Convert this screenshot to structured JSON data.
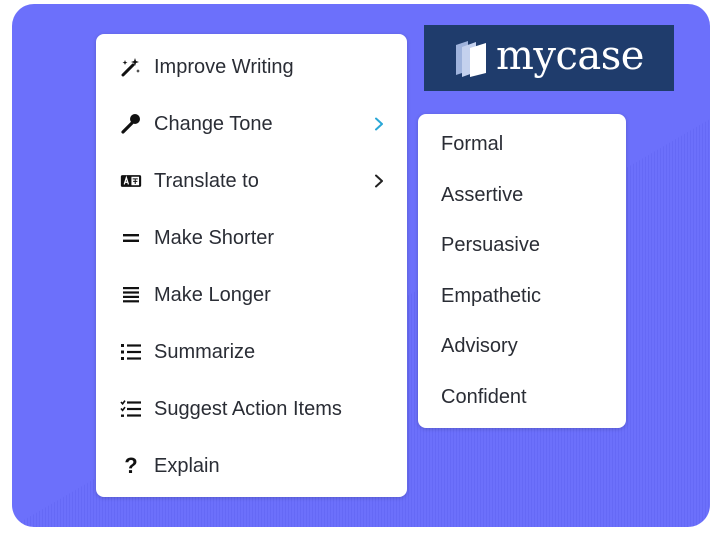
{
  "logo": {
    "text": "mycase"
  },
  "menu": {
    "items": [
      {
        "label": "Improve Writing",
        "icon": "magic-wand-icon"
      },
      {
        "label": "Change Tone",
        "icon": "microphone-icon",
        "has_submenu": true,
        "active": true
      },
      {
        "label": "Translate to",
        "icon": "translate-icon",
        "has_submenu": true
      },
      {
        "label": "Make Shorter",
        "icon": "short-lines-icon"
      },
      {
        "label": "Make Longer",
        "icon": "long-lines-icon"
      },
      {
        "label": "Summarize",
        "icon": "bullet-list-icon"
      },
      {
        "label": "Suggest Action Items",
        "icon": "checklist-icon"
      },
      {
        "label": "Explain",
        "icon": "question-icon"
      }
    ]
  },
  "submenu": {
    "items": [
      {
        "label": "Formal"
      },
      {
        "label": "Assertive"
      },
      {
        "label": "Persuasive"
      },
      {
        "label": "Empathetic"
      },
      {
        "label": "Advisory"
      },
      {
        "label": "Confident"
      }
    ]
  },
  "colors": {
    "background": "#6c70fb",
    "logo_bg": "#1f3c6c",
    "active_chevron": "#2aa7d6",
    "text": "#2a2d35"
  }
}
